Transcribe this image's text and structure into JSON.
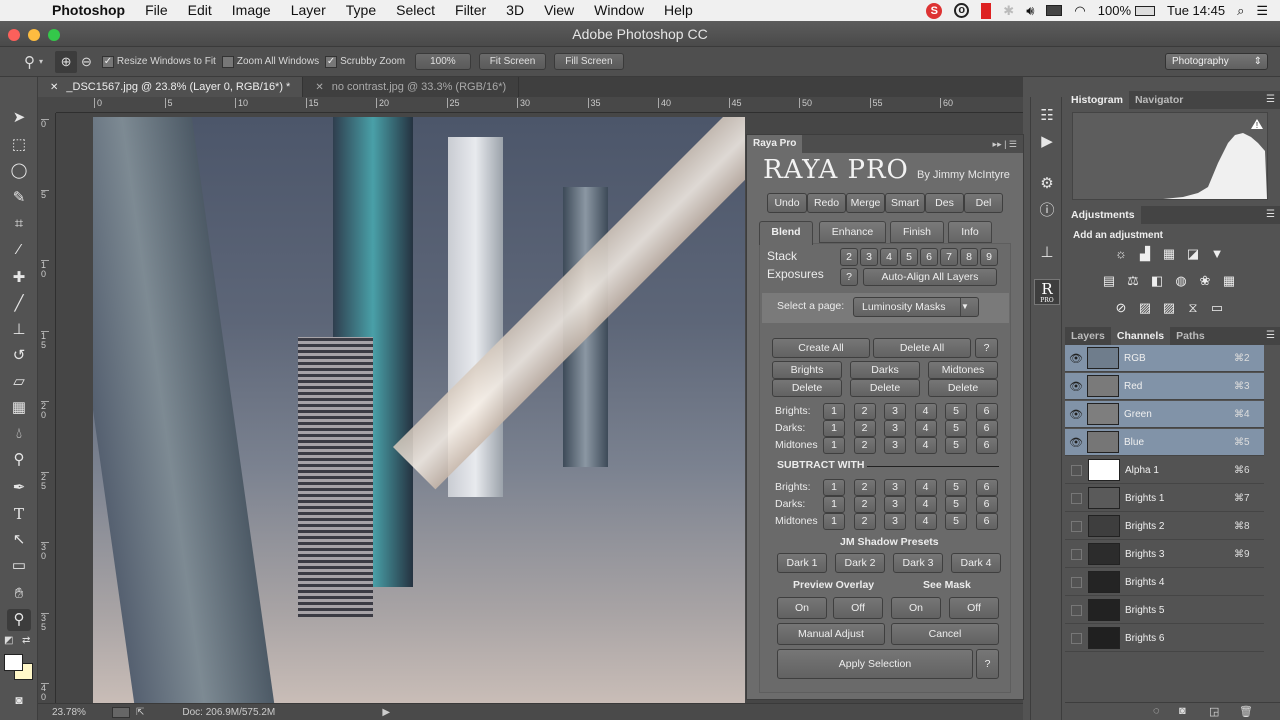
{
  "menubar": {
    "app_name": "Photoshop",
    "items": [
      "File",
      "Edit",
      "Image",
      "Layer",
      "Type",
      "Select",
      "Filter",
      "3D",
      "View",
      "Window",
      "Help"
    ],
    "battery": "100%",
    "clock": "Tue 14:45"
  },
  "window": {
    "title": "Adobe Photoshop CC"
  },
  "options_bar": {
    "resize_windows": "Resize Windows to Fit",
    "zoom_all": "Zoom All Windows",
    "scrubby": "Scrubby Zoom",
    "btn_100": "100%",
    "btn_fit": "Fit Screen",
    "btn_fill": "Fill Screen",
    "workspace": "Photography",
    "resize_checked": true,
    "zoom_all_checked": false,
    "scrubby_checked": true
  },
  "doc_tabs": [
    {
      "label": "_DSC1567.jpg @ 23.8% (Layer 0, RGB/16*) *",
      "active": true
    },
    {
      "label": "no contrast.jpg @ 33.3% (RGB/16*)",
      "active": false
    }
  ],
  "rulers": {
    "h": [
      "0",
      "5",
      "10",
      "15",
      "20",
      "25",
      "30",
      "35",
      "40",
      "45",
      "50",
      "55",
      "60"
    ],
    "v": [
      "0",
      "5",
      "10",
      "15",
      "20",
      "25",
      "30",
      "35",
      "40"
    ]
  },
  "status": {
    "zoom": "23.78%",
    "doc": "Doc: 206.9M/575.2M"
  },
  "raya": {
    "panel_tab": "Raya Pro",
    "logo": "RAYA PRO",
    "byline": "By Jimmy McIntyre",
    "top_buttons": [
      "Undo",
      "Redo",
      "Merge",
      "Smart",
      "Des",
      "Del"
    ],
    "tabs": [
      "Blend",
      "Enhance",
      "Finish",
      "Info"
    ],
    "stack_label": "Stack",
    "exposures_label": "Exposures",
    "stack_numbers": [
      "2",
      "3",
      "4",
      "5",
      "6",
      "7",
      "8",
      "9"
    ],
    "help": "?",
    "auto_align": "Auto-Align All Layers",
    "select_page_label": "Select a page:",
    "select_page_value": "Luminosity Masks",
    "create_all": "Create All",
    "delete_all": "Delete All",
    "groups": [
      "Brights",
      "Darks",
      "Midtones"
    ],
    "delete": "Delete",
    "row_labels": [
      "Brights:",
      "Darks:",
      "Midtones"
    ],
    "numbers": [
      "1",
      "2",
      "3",
      "4",
      "5",
      "6"
    ],
    "subtract_with": "SUBTRACT WITH",
    "shadow_presets_title": "JM Shadow Presets",
    "shadow_presets": [
      "Dark 1",
      "Dark 2",
      "Dark 3",
      "Dark 4"
    ],
    "preview_overlay": "Preview Overlay",
    "see_mask": "See Mask",
    "on": "On",
    "off": "Off",
    "manual_adjust": "Manual Adjust",
    "cancel": "Cancel",
    "apply_selection": "Apply Selection"
  },
  "histogram_panel": {
    "tabs": [
      "Histogram",
      "Navigator"
    ]
  },
  "adjustments_panel": {
    "title": "Adjustments",
    "subtitle": "Add an adjustment"
  },
  "channels_panel": {
    "tabs": [
      "Layers",
      "Channels",
      "Paths"
    ],
    "channels": [
      {
        "name": "RGB",
        "shortcut": "⌘2",
        "visible": true,
        "selected": true
      },
      {
        "name": "Red",
        "shortcut": "⌘3",
        "visible": true,
        "selected": true
      },
      {
        "name": "Green",
        "shortcut": "⌘4",
        "visible": true,
        "selected": true
      },
      {
        "name": "Blue",
        "shortcut": "⌘5",
        "visible": true,
        "selected": true
      },
      {
        "name": "Alpha 1",
        "shortcut": "⌘6",
        "visible": false,
        "selected": false
      },
      {
        "name": "Brights 1",
        "shortcut": "⌘7",
        "visible": false,
        "selected": false
      },
      {
        "name": "Brights 2",
        "shortcut": "⌘8",
        "visible": false,
        "selected": false
      },
      {
        "name": "Brights 3",
        "shortcut": "⌘9",
        "visible": false,
        "selected": false
      },
      {
        "name": "Brights 4",
        "shortcut": "",
        "visible": false,
        "selected": false
      },
      {
        "name": "Brights 5",
        "shortcut": "",
        "visible": false,
        "selected": false
      },
      {
        "name": "Brights 6",
        "shortcut": "",
        "visible": false,
        "selected": false
      }
    ]
  }
}
